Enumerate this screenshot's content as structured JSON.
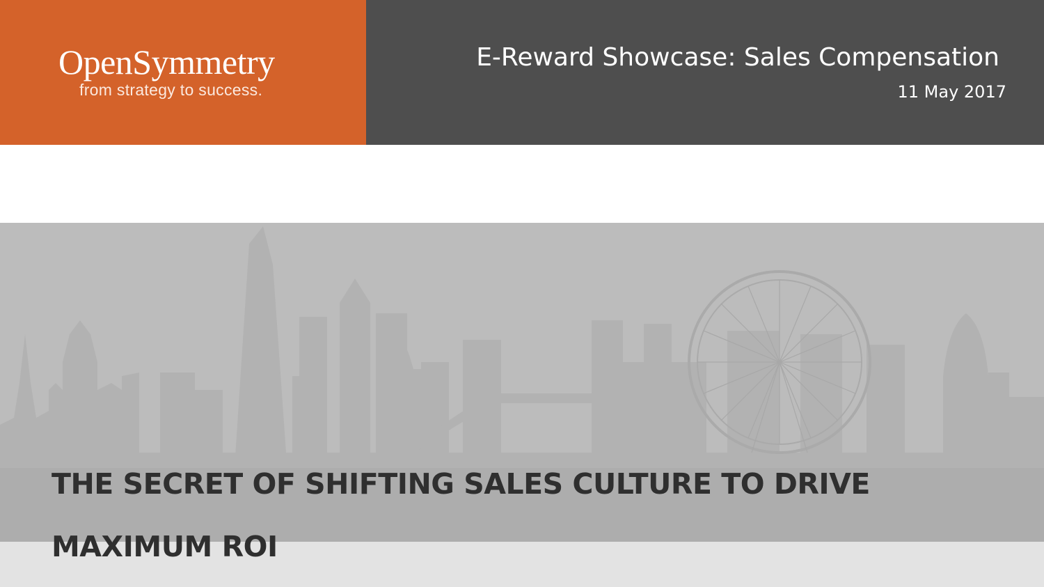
{
  "logo": {
    "name": "OpenSymmetry",
    "tagline": "from strategy to success."
  },
  "event": {
    "title": "E-Reward Showcase: Sales Compensation",
    "date": "11 May 2017"
  },
  "headline": {
    "line1": "THE SECRET OF SHIFTING SALES CULTURE TO DRIVE",
    "line2": "MAXIMUM ROI"
  },
  "colors": {
    "brand_orange": "#d4622a",
    "header_dark": "#4e4e4e",
    "banner_gray": "#bcbcbc",
    "skyline_gray": "#aeaeae",
    "headline_text": "#2f2f2f"
  },
  "banner": {
    "illustration": "london-skyline"
  }
}
